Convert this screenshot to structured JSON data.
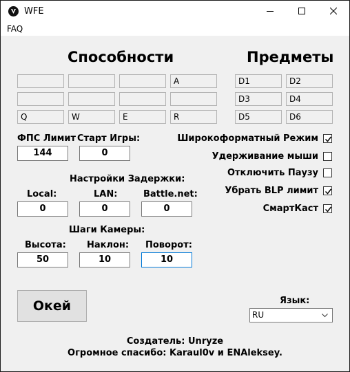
{
  "window": {
    "title": "WFE"
  },
  "menu": {
    "faq": "FAQ"
  },
  "abilities": {
    "title": "Способности",
    "slots": [
      "",
      "",
      "",
      "A",
      "",
      "",
      "",
      "",
      "Q",
      "W",
      "E",
      "R"
    ]
  },
  "items": {
    "title": "Предметы",
    "slots": [
      "D1",
      "D2",
      "D3",
      "D4",
      "D5",
      "D6"
    ]
  },
  "fps": {
    "limit_label": "ФПС Лимит",
    "limit_value": "144",
    "start_label": "Старт Игры:",
    "start_value": "0"
  },
  "delay": {
    "title": "Настройки Задержки:",
    "local_label": "Local:",
    "local_value": "0",
    "lan_label": "LAN:",
    "lan_value": "0",
    "battlenet_label": "Battle.net:",
    "battlenet_value": "0"
  },
  "camera": {
    "title": "Шаги Камеры:",
    "height_label": "Высота:",
    "height_value": "50",
    "tilt_label": "Наклон:",
    "tilt_value": "10",
    "rotation_label": "Поворот:",
    "rotation_value": "10"
  },
  "options": [
    {
      "label": "Широкоформатный Режим",
      "checked": true
    },
    {
      "label": "Удерживание мыши",
      "checked": false
    },
    {
      "label": "Отключить Паузу",
      "checked": false
    },
    {
      "label": "Убрать BLP лимит",
      "checked": true
    },
    {
      "label": "СмартКаст",
      "checked": true
    }
  ],
  "ok_button": "Окей",
  "language": {
    "label": "Язык:",
    "value": "RU"
  },
  "credits": {
    "author": "Создатель: Unryze",
    "thanks": "Огромное спасибо: Karaul0v и ENAleksey."
  },
  "colors": {
    "window_bg": "#f0f0f0",
    "focus_border": "#0078d7"
  },
  "icons": [
    "app-logo-icon",
    "minimize-icon",
    "maximize-icon",
    "close-icon",
    "checkmark-icon",
    "chevron-down-icon"
  ]
}
